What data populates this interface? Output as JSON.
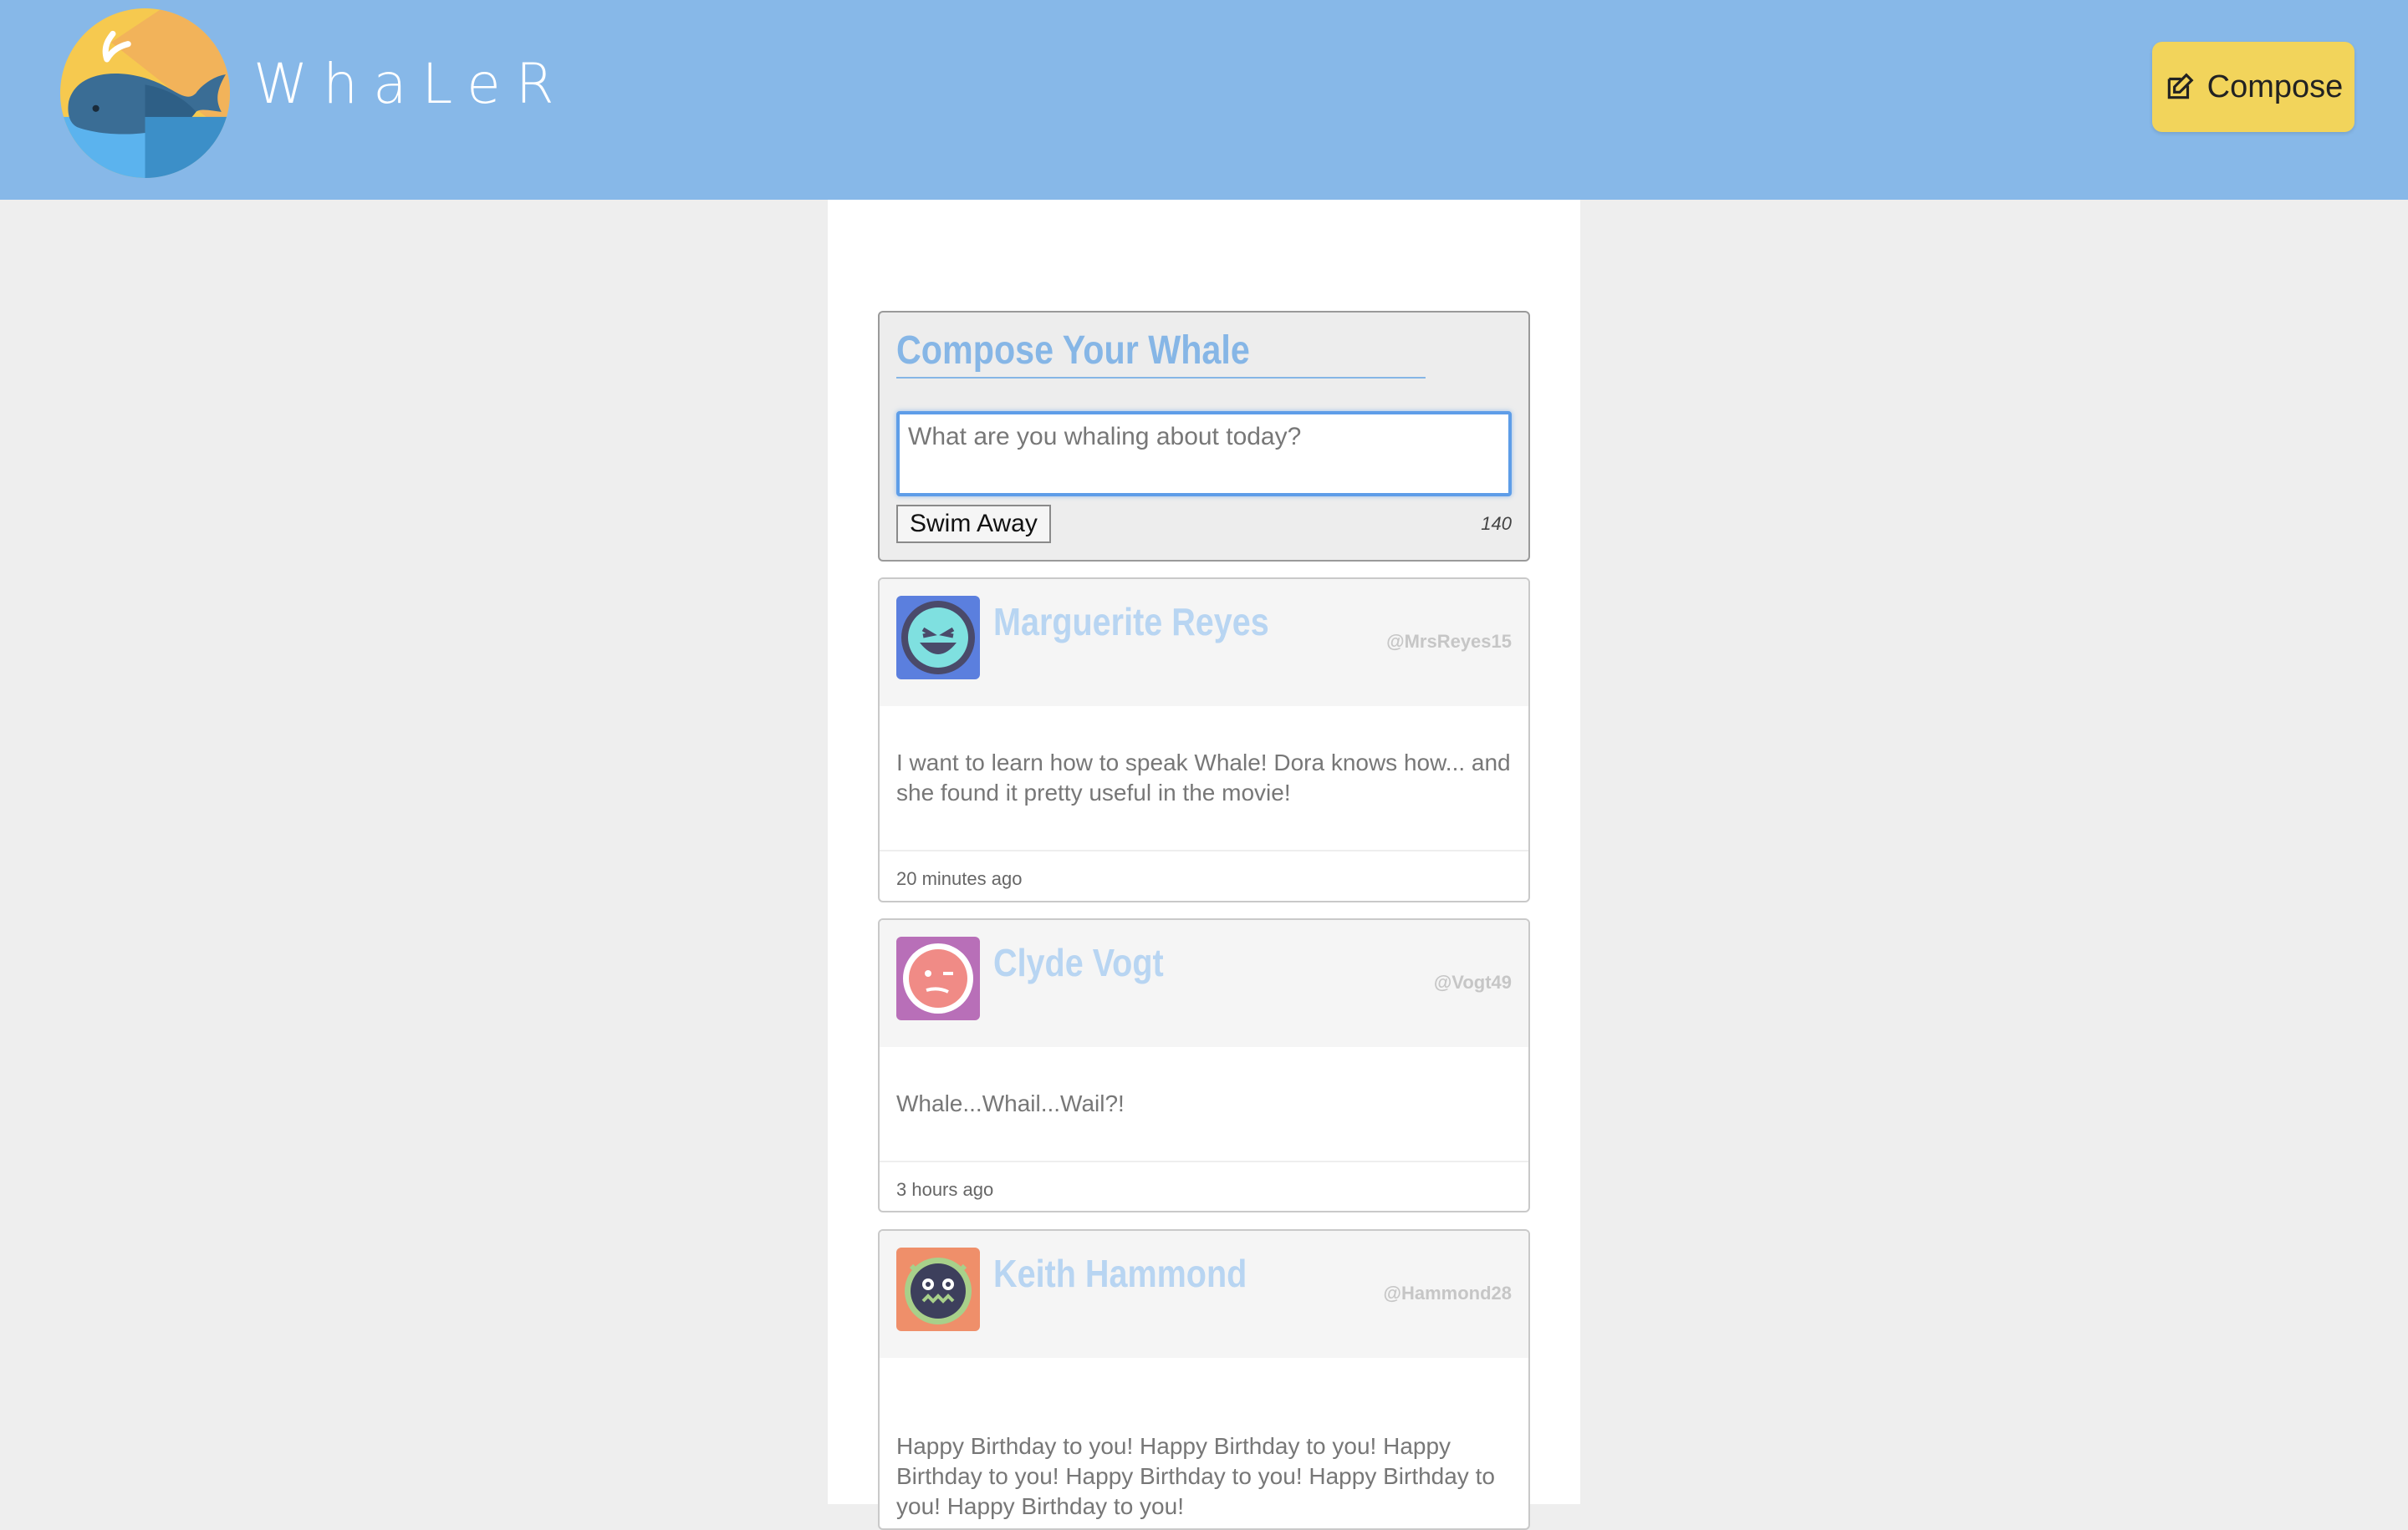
{
  "app": {
    "brand": "WhaLeR"
  },
  "header": {
    "compose_label": "Compose"
  },
  "composer": {
    "title": "Compose Your Whale",
    "placeholder": "What are you whaling about today?",
    "submit_label": "Swim Away",
    "char_count": "140"
  },
  "posts": [
    {
      "name": "Marguerite Reyes",
      "handle": "@MrsReyes15",
      "text": "I want to learn how to speak Whale! Dora knows how... and she found it pretty useful in the movie!",
      "time": "20 minutes ago",
      "avatar_color": "#5b7fde"
    },
    {
      "name": "Clyde Vogt",
      "handle": "@Vogt49",
      "text": "Whale...Whail...Wail?!",
      "time": "3 hours ago",
      "avatar_color": "#b86fb8"
    },
    {
      "name": "Keith Hammond",
      "handle": "@Hammond28",
      "text": "Happy Birthday to you! Happy Birthday to you! Happy Birthday to you!  Happy Birthday to you! Happy Birthday to you! Happy Birthday to you!",
      "time": "",
      "avatar_color": "#ef8f6a"
    }
  ],
  "colors": {
    "header_bg": "#87b8e8",
    "compose_button": "#f2d45b",
    "accent_blue": "#86b6e6"
  }
}
